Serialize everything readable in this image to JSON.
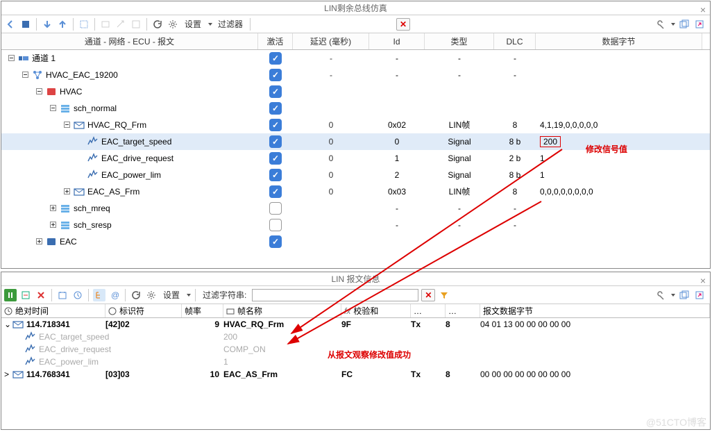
{
  "upper": {
    "title": "LIN剩余总线仿真",
    "header": {
      "chan": "通道 - 网络 - ECU - 报文",
      "activate": "激活",
      "delay": "延迟 (毫秒)",
      "id": "Id",
      "type": "类型",
      "dlc": "DLC",
      "data": "数据字节"
    },
    "toolbar": {
      "settings": "设置",
      "filter": "过滤器"
    },
    "rows": [
      {
        "indent": 0,
        "exp": "minus",
        "icon": "channel",
        "label": "通道 1",
        "chk": true,
        "delay": "-",
        "id": "-",
        "type": "-",
        "dlc": "-",
        "data": ""
      },
      {
        "indent": 1,
        "exp": "minus",
        "icon": "net",
        "label": "HVAC_EAC_19200",
        "chk": true,
        "delay": "-",
        "id": "-",
        "type": "-",
        "dlc": "-",
        "data": ""
      },
      {
        "indent": 2,
        "exp": "minus",
        "icon": "ecu-red",
        "label": "HVAC",
        "chk": true,
        "delay": "",
        "id": "",
        "type": "",
        "dlc": "",
        "data": ""
      },
      {
        "indent": 3,
        "exp": "minus",
        "icon": "sched",
        "label": "sch_normal",
        "chk": true,
        "delay": "",
        "id": "",
        "type": "",
        "dlc": "",
        "data": ""
      },
      {
        "indent": 4,
        "exp": "minus",
        "icon": "msg",
        "label": "HVAC_RQ_Frm",
        "chk": true,
        "delay": "0",
        "id": "0x02",
        "type": "LIN帧",
        "dlc": "8",
        "data": "4,1,19,0,0,0,0,0"
      },
      {
        "indent": 5,
        "exp": "",
        "icon": "sig",
        "label": "EAC_target_speed",
        "chk": true,
        "delay": "0",
        "id": "0",
        "type": "Signal",
        "dlc": "8 b",
        "data": "200",
        "boxed": true,
        "hilite": true
      },
      {
        "indent": 5,
        "exp": "",
        "icon": "sig",
        "label": "EAC_drive_request",
        "chk": true,
        "delay": "0",
        "id": "1",
        "type": "Signal",
        "dlc": "2 b",
        "data": "1"
      },
      {
        "indent": 5,
        "exp": "",
        "icon": "sig",
        "label": "EAC_power_lim",
        "chk": true,
        "delay": "0",
        "id": "2",
        "type": "Signal",
        "dlc": "8 b",
        "data": "1"
      },
      {
        "indent": 4,
        "exp": "plus",
        "icon": "msg",
        "label": "EAC_AS_Frm",
        "chk": true,
        "delay": "0",
        "id": "0x03",
        "type": "LIN帧",
        "dlc": "8",
        "data": "0,0,0,0,0,0,0,0"
      },
      {
        "indent": 3,
        "exp": "plus",
        "icon": "sched",
        "label": "sch_mreq",
        "chk": false,
        "delay": "",
        "id": "-",
        "type": "-",
        "dlc": "-",
        "data": ""
      },
      {
        "indent": 3,
        "exp": "plus",
        "icon": "sched",
        "label": "sch_sresp",
        "chk": false,
        "delay": "",
        "id": "-",
        "type": "-",
        "dlc": "-",
        "data": ""
      },
      {
        "indent": 2,
        "exp": "plus",
        "icon": "ecu-blue",
        "label": "EAC",
        "chk": true,
        "delay": "",
        "id": "",
        "type": "",
        "dlc": "",
        "data": ""
      }
    ],
    "annot1": "修改信号值"
  },
  "lower": {
    "title": "LIN 报文信息",
    "toolbar": {
      "settings": "设置",
      "filter_label": "过滤字符串:"
    },
    "header": {
      "time": "绝对时间",
      "id": "标识符",
      "rate": "帧率",
      "name": "帧名称",
      "chk": "校验和",
      "dir": "…",
      "dlc": "…",
      "data": "报文数据字节"
    },
    "rows": [
      {
        "kind": "msg",
        "exp": "open",
        "time": "114.718341",
        "id": "[42]02",
        "rate": "9",
        "name": "HVAC_RQ_Frm",
        "chk": "9F",
        "dir": "Tx",
        "dlc": "8",
        "data": "04 01 13 00 00 00 00 00"
      },
      {
        "kind": "sig",
        "name": "EAC_target_speed",
        "val": "200"
      },
      {
        "kind": "sig",
        "name": "EAC_drive_request",
        "val": "COMP_ON"
      },
      {
        "kind": "sig",
        "name": "EAC_power_lim",
        "val": "1"
      },
      {
        "kind": "msg",
        "exp": "closed",
        "time": "114.768341",
        "id": "[03]03",
        "rate": "10",
        "name": "EAC_AS_Frm",
        "chk": "FC",
        "dir": "Tx",
        "dlc": "8",
        "data": "00 00 00 00 00 00 00 00"
      }
    ],
    "annot2": "从报文观察修改值成功"
  },
  "watermark": "@51CTO博客"
}
